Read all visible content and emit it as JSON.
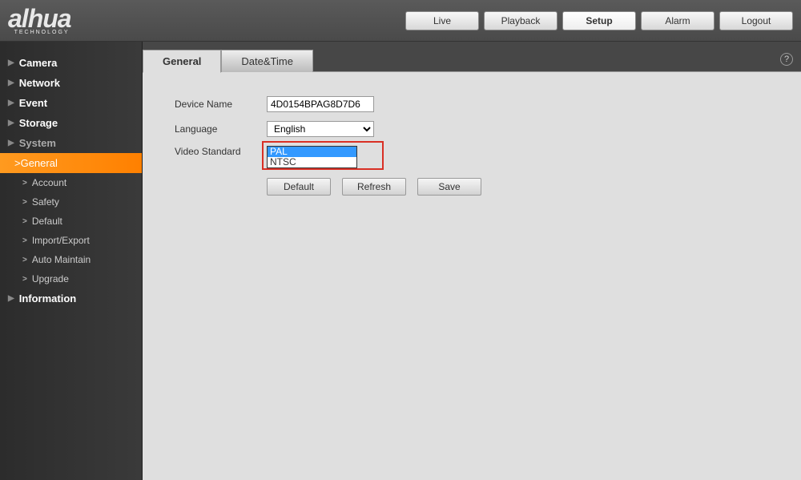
{
  "brand": {
    "name": "alhua",
    "sub": "TECHNOLOGY"
  },
  "nav": {
    "live": "Live",
    "playback": "Playback",
    "setup": "Setup",
    "alarm": "Alarm",
    "logout": "Logout"
  },
  "sidebar": {
    "camera": "Camera",
    "network": "Network",
    "event": "Event",
    "storage": "Storage",
    "system": "System",
    "general": "General",
    "account": "Account",
    "safety": "Safety",
    "default": "Default",
    "import_export": "Import/Export",
    "auto_maintain": "Auto Maintain",
    "upgrade": "Upgrade",
    "information": "Information"
  },
  "tabs": {
    "general": "General",
    "datetime": "Date&Time"
  },
  "form": {
    "device_name_label": "Device Name",
    "device_name_value": "4D0154BPAG8D7D6",
    "language_label": "Language",
    "language_value": "English",
    "video_standard_label": "Video Standard",
    "video_standard_options": {
      "pal": "PAL",
      "ntsc": "NTSC"
    }
  },
  "buttons": {
    "default": "Default",
    "refresh": "Refresh",
    "save": "Save"
  },
  "help": "?"
}
